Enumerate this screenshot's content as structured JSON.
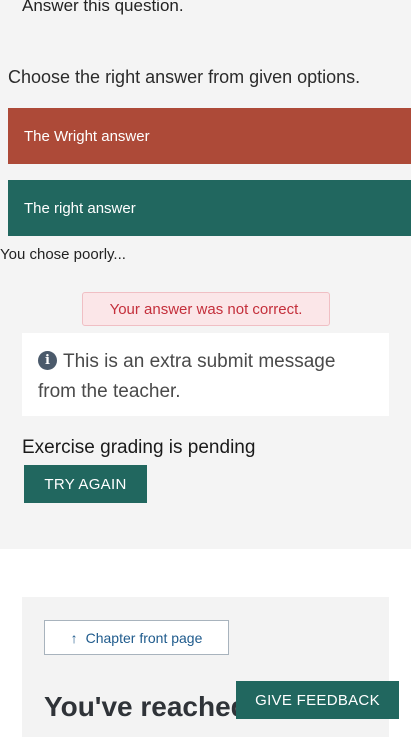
{
  "exercise": {
    "question_prompt": "Answer this question.",
    "instructions": "Choose the right answer from given options.",
    "options": [
      {
        "label": "The Wright answer",
        "state": "incorrect"
      },
      {
        "label": "The right answer",
        "state": "correct"
      }
    ],
    "choice_feedback": "You chose poorly...",
    "result_message": "Your answer was not correct.",
    "extra_message": "This is an extra submit message from the teacher.",
    "extra_message_icon": "info-circle-icon",
    "grading_status": "Exercise grading is pending",
    "try_again_label": "TRY AGAIN"
  },
  "navigation": {
    "chapter_button_label": "Chapter front page",
    "chapter_button_icon": "arrow-up-icon",
    "end_heading": "You've reached"
  },
  "feedback": {
    "button_label": "GIVE FEEDBACK"
  },
  "colors": {
    "incorrect_option": "#ad4a38",
    "correct_option": "#21675f",
    "error_text": "#c42f3b",
    "primary_button": "#21675f"
  }
}
